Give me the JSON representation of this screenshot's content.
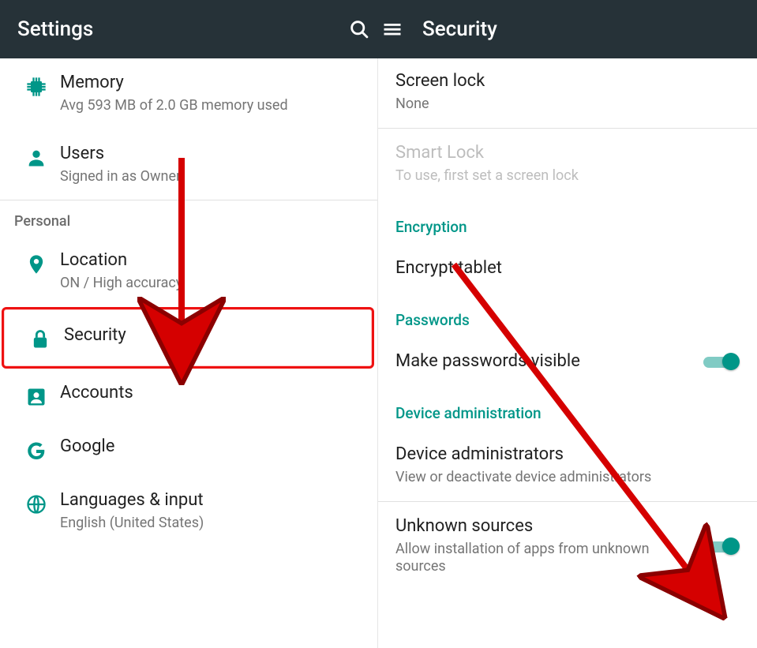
{
  "appbar_left_title": "Settings",
  "appbar_right_title": "Security",
  "left": {
    "memory": {
      "title": "Memory",
      "sub": "Avg 593 MB of 2.0 GB memory used"
    },
    "users": {
      "title": "Users",
      "sub": "Signed in as Owner"
    },
    "section_personal": "Personal",
    "location": {
      "title": "Location",
      "sub": "ON / High accuracy"
    },
    "security": {
      "title": "Security"
    },
    "accounts": {
      "title": "Accounts"
    },
    "google": {
      "title": "Google"
    },
    "languages": {
      "title": "Languages & input",
      "sub": "English (United States)"
    }
  },
  "right": {
    "screen_lock": {
      "title": "Screen lock",
      "sub": "None"
    },
    "smart_lock": {
      "title": "Smart Lock",
      "sub": "To use, first set a screen lock"
    },
    "header_encryption": "Encryption",
    "encrypt_tablet": {
      "title": "Encrypt tablet"
    },
    "header_passwords": "Passwords",
    "make_pw_visible": {
      "title": "Make passwords visible",
      "on": true
    },
    "header_device_admin": "Device administration",
    "device_admins": {
      "title": "Device administrators",
      "sub": "View or deactivate device administrators"
    },
    "unknown_sources": {
      "title": "Unknown sources",
      "sub": "Allow installation of apps from unknown sources",
      "on": true
    }
  },
  "colors": {
    "accent": "#009688",
    "header_bg": "#263238",
    "annotation": "#d50000"
  }
}
